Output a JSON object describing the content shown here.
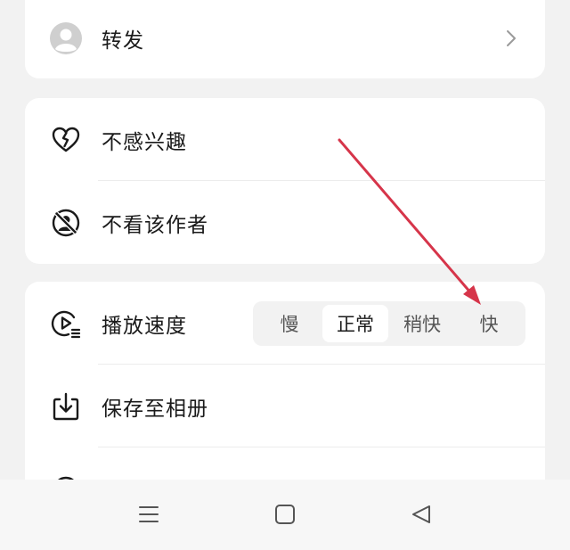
{
  "forward": {
    "label": "转发",
    "icon": "avatar-icon"
  },
  "feedback": {
    "not_interested_label": "不感兴趣",
    "not_interested_icon": "broken-heart-icon",
    "hide_author_label": "不看该作者",
    "hide_author_icon": "block-user-icon"
  },
  "options": {
    "speed": {
      "label": "播放速度",
      "icon": "play-speed-icon",
      "choices": [
        "慢",
        "正常",
        "稍快",
        "快"
      ],
      "selected": "正常"
    },
    "save": {
      "label": "保存至相册",
      "icon": "download-icon"
    }
  },
  "navbar": {
    "menu_icon": "menu-icon",
    "home_icon": "home-square-icon",
    "back_icon": "back-triangle-icon"
  },
  "colors": {
    "background": "#f2f2f2",
    "card": "#ffffff",
    "annotation_arrow": "#d6354a"
  }
}
